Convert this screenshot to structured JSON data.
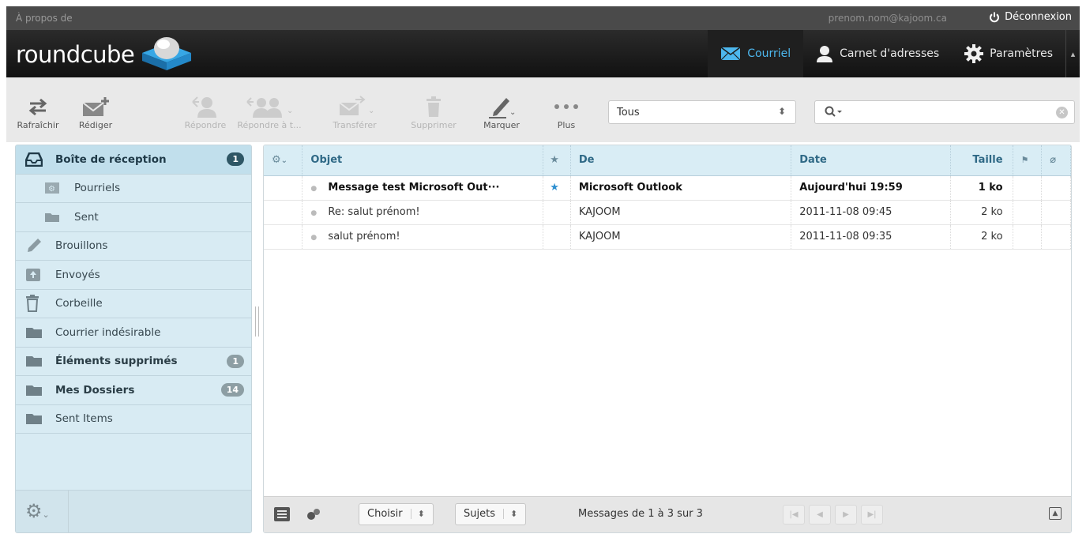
{
  "topline": {
    "about": "À propos de",
    "user": "prenom.nom@kajoom.ca",
    "logout": "Déconnexion"
  },
  "logo": {
    "text": "roundcube"
  },
  "tasks": [
    {
      "label": "Courriel",
      "icon": "envelope-icon",
      "selected": true
    },
    {
      "label": "Carnet d'adresses",
      "icon": "person-icon",
      "selected": false
    },
    {
      "label": "Paramètres",
      "icon": "gear-icon",
      "selected": false
    }
  ],
  "toolbar": {
    "refresh": "Rafraîchir",
    "compose": "Rédiger",
    "reply": "Répondre",
    "reply_all": "Répondre à t...",
    "forward": "Transférer",
    "delete": "Supprimer",
    "mark": "Marquer",
    "more": "Plus",
    "filter_value": "Tous"
  },
  "folders": [
    {
      "label": "Boîte de réception",
      "badge": "1",
      "selected": true,
      "icon": "inbox-icon"
    },
    {
      "label": "Pourriels",
      "sub": true,
      "icon": "junk-icon"
    },
    {
      "label": "Sent",
      "sub": true,
      "icon": "folder-icon"
    },
    {
      "label": "Brouillons",
      "icon": "pencil-icon"
    },
    {
      "label": "Envoyés",
      "icon": "sent-icon"
    },
    {
      "label": "Corbeille",
      "icon": "trash-icon"
    },
    {
      "label": "Courrier indésirable",
      "icon": "folder-icon"
    },
    {
      "label": "Éléments supprimés",
      "badge": "1",
      "bold": true,
      "icon": "folder-icon"
    },
    {
      "label": "Mes Dossiers",
      "badge": "14",
      "bold": true,
      "icon": "folder-icon"
    },
    {
      "label": "Sent Items",
      "icon": "folder-icon"
    }
  ],
  "columns": {
    "subject": "Objet",
    "from": "De",
    "date": "Date",
    "size": "Taille"
  },
  "messages": [
    {
      "subject": "Message test Microsoft Out···",
      "flagged": true,
      "from": "Microsoft Outlook",
      "date": "Aujourd'hui 19:59",
      "size": "1 ko",
      "unread": true
    },
    {
      "subject": "Re: salut prénom!",
      "flagged": false,
      "from": "KAJOOM",
      "date": "2011-11-08 09:45",
      "size": "2 ko",
      "unread": false
    },
    {
      "subject": "salut prénom!",
      "flagged": false,
      "from": "KAJOOM",
      "date": "2011-11-08 09:35",
      "size": "2 ko",
      "unread": false
    }
  ],
  "footer": {
    "select": "Choisir",
    "threads": "Sujets",
    "count": "Messages de 1 à 3 sur 3"
  }
}
